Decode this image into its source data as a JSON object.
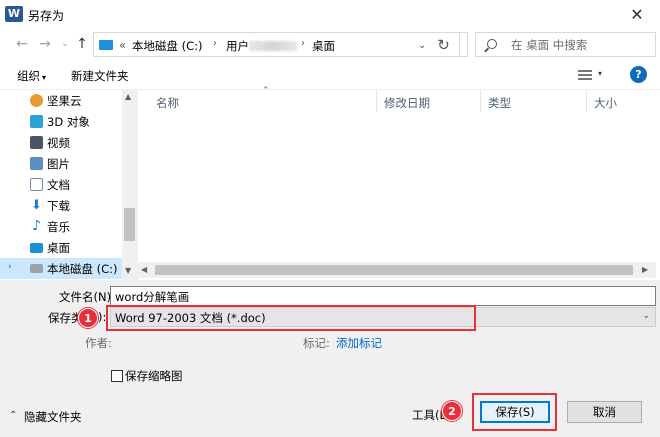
{
  "window": {
    "title": "另存为",
    "app_icon": "W"
  },
  "nav": {
    "breadcrumbs": [
      "«",
      "本地磁盘 (C:)",
      "用户",
      "桌面"
    ],
    "search_placeholder": "在 桌面 中搜索"
  },
  "toolbar": {
    "organize": "组织",
    "new_folder": "新建文件夹",
    "help": "?"
  },
  "sidebar": {
    "items": [
      {
        "label": "坚果云",
        "icon": "cloud-icon"
      },
      {
        "label": "3D 对象",
        "icon": "3d-objects-icon"
      },
      {
        "label": "视频",
        "icon": "video-icon"
      },
      {
        "label": "图片",
        "icon": "pictures-icon"
      },
      {
        "label": "文档",
        "icon": "documents-icon"
      },
      {
        "label": "下载",
        "icon": "download-icon"
      },
      {
        "label": "音乐",
        "icon": "music-icon"
      },
      {
        "label": "桌面",
        "icon": "desktop-icon"
      },
      {
        "label": "本地磁盘 (C:)",
        "icon": "drive-icon"
      }
    ]
  },
  "filelist": {
    "columns": [
      "名称",
      "修改日期",
      "类型",
      "大小"
    ]
  },
  "form": {
    "filename_label": "文件名(N):",
    "filename_value": "word分解笔画",
    "filetype_label_visible": "保存类",
    "filetype_label_tail": "):",
    "filetype_value": "Word 97-2003 文档 (*.doc)",
    "author_label": "作者:",
    "tags_label": "标记:",
    "tags_link": "添加标记",
    "thumbnail_label": "保存缩略图"
  },
  "footer": {
    "hide_folders": "隐藏文件夹",
    "tools": "工具(L)",
    "save": "保存(S)",
    "cancel": "取消"
  },
  "annotations": {
    "badge1": "1",
    "badge2": "2"
  },
  "colors": {
    "accent": "#0078d7",
    "highlight_red": "#e8303a",
    "selected_bg": "#cce8ff"
  }
}
